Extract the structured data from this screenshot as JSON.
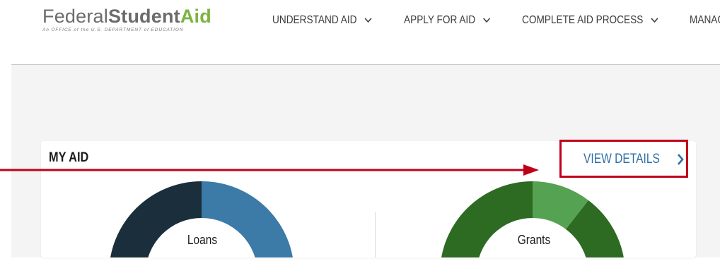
{
  "header": {
    "logo": {
      "federal": "Federal",
      "student": "Student",
      "aid": "Aid",
      "tagline": "An OFFICE of the U.S. DEPARTMENT of EDUCATION"
    },
    "nav": [
      {
        "label": "UNDERSTAND AID",
        "icon": "chevron-down-icon"
      },
      {
        "label": "APPLY FOR AID",
        "icon": "chevron-down-icon"
      },
      {
        "label": "COMPLETE AID PROCESS",
        "icon": "chevron-down-icon"
      },
      {
        "label": "MANAG"
      }
    ]
  },
  "card": {
    "title": "MY AID",
    "view_details": "VIEW DETAILS",
    "view_details_icon": "chevron-right-icon"
  },
  "charts": [
    {
      "label": "Loans",
      "colors": [
        "#1b2e3c",
        "#3c7aa8"
      ]
    },
    {
      "label": "Grants",
      "colors": [
        "#2d6a22",
        "#55a352"
      ]
    }
  ],
  "colors": {
    "highlight_box": "#c0001a",
    "link": "#2f6fa5",
    "brand_green": "#7cb342"
  }
}
